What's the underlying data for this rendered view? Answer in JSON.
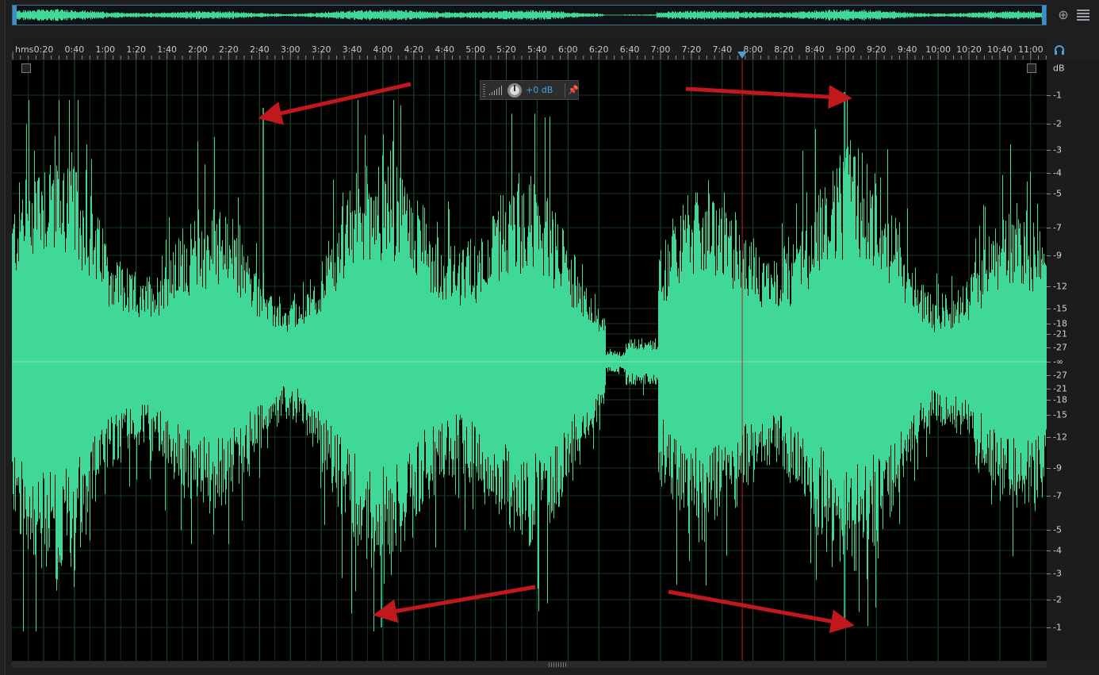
{
  "ruler": {
    "unit_label": "hms",
    "ticks": [
      "0:20",
      "0:40",
      "1:00",
      "1:20",
      "1:40",
      "2:00",
      "2:20",
      "2:40",
      "3:00",
      "3:20",
      "3:40",
      "4:00",
      "4:20",
      "4:40",
      "5:00",
      "5:20",
      "5:40",
      "6:00",
      "6:20",
      "6:40",
      "7:00",
      "7:20",
      "7:40",
      "8:00",
      "8:20",
      "8:40",
      "9:00",
      "9:20",
      "9:40",
      "10:00",
      "10:20",
      "10:40",
      "11:00"
    ]
  },
  "hud": {
    "gain_value": "+0 dB",
    "pin_glyph": "📌"
  },
  "db_scale": {
    "unit_label": "dB",
    "labels": [
      "-1",
      "-2",
      "-3",
      "-4",
      "-5",
      "-7",
      "-9",
      "-12",
      "-15",
      "-18",
      "-21",
      "-27",
      "-∞",
      "-27",
      "-21",
      "-18",
      "-15",
      "-12",
      "-9",
      "-7",
      "-5",
      "-4",
      "-3",
      "-2",
      "-1"
    ]
  },
  "playhead": {
    "time": "7:53"
  },
  "annotations": {
    "arrow_color": "#c0181c",
    "arrow_count": 4
  },
  "colors": {
    "waveform": "#3fd896",
    "background": "#000000",
    "playhead": "#c02020",
    "accent": "#4a9fd8"
  },
  "icons": {
    "zoom": "zoom-icon",
    "menu": "menu-icon",
    "headphones": "headphones-icon",
    "knob": "knob-icon",
    "pin": "pin-icon",
    "meter": "meter-icon"
  }
}
